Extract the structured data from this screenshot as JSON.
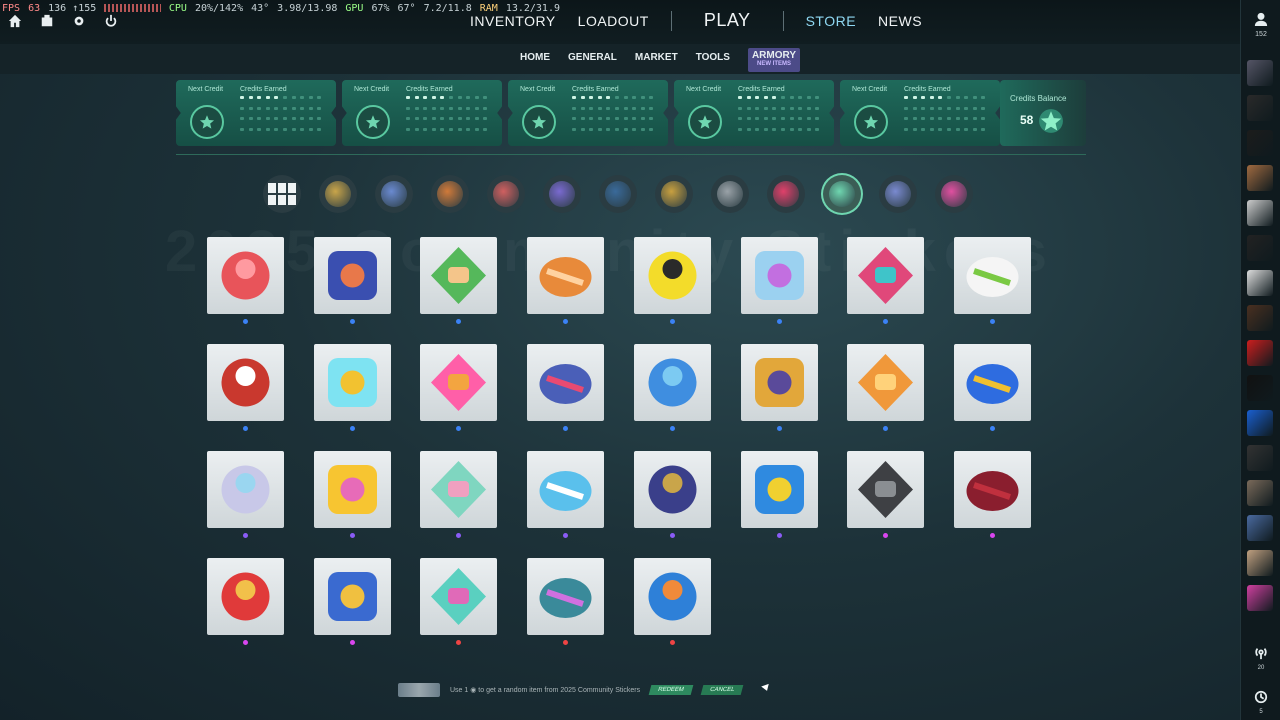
{
  "overlay": {
    "fps_label": "FPS",
    "fps": "63",
    "fps_range": "136 ↑155",
    "cpu_label": "CPU",
    "cpu": "20%/142%",
    "cpu_temp": "43°",
    "cpu_clock": "3.98/13.98",
    "gpu_label": "GPU",
    "gpu": "67%",
    "gpu_temp": "67°",
    "gpu_mem": "7.2/11.8",
    "ram_label": "RAM",
    "ram": "13.2/31.9"
  },
  "nav": {
    "inventory": "INVENTORY",
    "loadout": "LOADOUT",
    "play": "PLAY",
    "store": "STORE",
    "news": "NEWS"
  },
  "subnav": {
    "home": "HOME",
    "general": "GENERAL",
    "market": "MARKET",
    "tools": "TOOLS",
    "armory": "ARMORY",
    "armory_badge": "NEW ITEMS"
  },
  "credits": {
    "next_label": "Next Credit",
    "earned_label": "Credits Earned",
    "cards": 5,
    "balance_label": "Credits Balance",
    "balance_value": "58"
  },
  "watermark": "2025 Community Stickers",
  "filters": [
    "all-grid",
    "ltd",
    "collection-1",
    "collection-2",
    "collection-3",
    "collection-4",
    "diamond",
    "gold",
    "silver",
    "red-diamond",
    "community-stickers",
    "collection-5",
    "collection-6"
  ],
  "items": [
    {
      "color": "#e8545a",
      "accent": "#ff9aa0",
      "rarity": "#3b82f6"
    },
    {
      "color": "#3a4fb0",
      "accent": "#e8784a",
      "rarity": "#3b82f6"
    },
    {
      "color": "#55b85b",
      "accent": "#f4c58a",
      "rarity": "#3b82f6"
    },
    {
      "color": "#e88a3a",
      "accent": "#ffd2a0",
      "rarity": "#3b82f6"
    },
    {
      "color": "#f3dc2a",
      "accent": "#2a2a2a",
      "rarity": "#3b82f6"
    },
    {
      "color": "#9bd1f0",
      "accent": "#c26fe0",
      "rarity": "#3b82f6"
    },
    {
      "color": "#e0487a",
      "accent": "#3fc4c9",
      "rarity": "#3b82f6"
    },
    {
      "color": "#f5f5f5",
      "accent": "#7ac943",
      "rarity": "#3b82f6"
    },
    {
      "color": "#c9382e",
      "accent": "#ffffff",
      "rarity": "#3b82f6"
    },
    {
      "color": "#7ee3f2",
      "accent": "#f2c230",
      "rarity": "#3b82f6"
    },
    {
      "color": "#ff5fa8",
      "accent": "#f3a540",
      "rarity": "#3b82f6"
    },
    {
      "color": "#4a5fb8",
      "accent": "#e84a72",
      "rarity": "#3b82f6"
    },
    {
      "color": "#3f8ee0",
      "accent": "#7ccaf2",
      "rarity": "#3b82f6"
    },
    {
      "color": "#e2a73a",
      "accent": "#5a4a9a",
      "rarity": "#3b82f6"
    },
    {
      "color": "#f0983a",
      "accent": "#ffd27a",
      "rarity": "#3b82f6"
    },
    {
      "color": "#2e6ce0",
      "accent": "#f0c030",
      "rarity": "#3b82f6"
    },
    {
      "color": "#c8c8e8",
      "accent": "#9ad6f0",
      "rarity": "#8b5cf6"
    },
    {
      "color": "#f7c531",
      "accent": "#e76bb8",
      "rarity": "#8b5cf6"
    },
    {
      "color": "#7fd6c0",
      "accent": "#f0a0c0",
      "rarity": "#8b5cf6"
    },
    {
      "color": "#5ac0ec",
      "accent": "#ffffff",
      "rarity": "#8b5cf6"
    },
    {
      "color": "#3a3f8a",
      "accent": "#c9a54a",
      "rarity": "#8b5cf6"
    },
    {
      "color": "#2f8ae0",
      "accent": "#f0d030",
      "rarity": "#8b5cf6"
    },
    {
      "color": "#3e4044",
      "accent": "#8a8e92",
      "rarity": "#d946ef"
    },
    {
      "color": "#8a1e2e",
      "accent": "#c0303e",
      "rarity": "#d946ef"
    },
    {
      "color": "#e03a3a",
      "accent": "#f2c04a",
      "rarity": "#d946ef"
    },
    {
      "color": "#3a6ad0",
      "accent": "#f0c040",
      "rarity": "#d946ef"
    },
    {
      "color": "#5ad0c0",
      "accent": "#e06ab8",
      "rarity": "#ef4444"
    },
    {
      "color": "#3a8a9a",
      "accent": "#d070e0",
      "rarity": "#ef4444"
    },
    {
      "color": "#2e80d8",
      "accent": "#f08a3a",
      "rarity": "#ef4444"
    }
  ],
  "bottom": {
    "text": "Use 1 ◉ to get a random item from 2025 Community Stickers",
    "redeem": "REDEEM",
    "cancel": "CANCEL"
  },
  "sidebar": {
    "friends_count": "152",
    "broadcast_count": "20",
    "history_count": "5",
    "avatars": [
      "#556",
      "#2a2a2a",
      "#1c1c1c",
      "#a06a40",
      "#ccc",
      "#222",
      "#ddd",
      "#4a3020",
      "#cc1e1e",
      "#111",
      "#1a5fd0",
      "#333",
      "#7a6a5a",
      "#4a6aa0",
      "#c0a080",
      "#d040a0"
    ]
  }
}
